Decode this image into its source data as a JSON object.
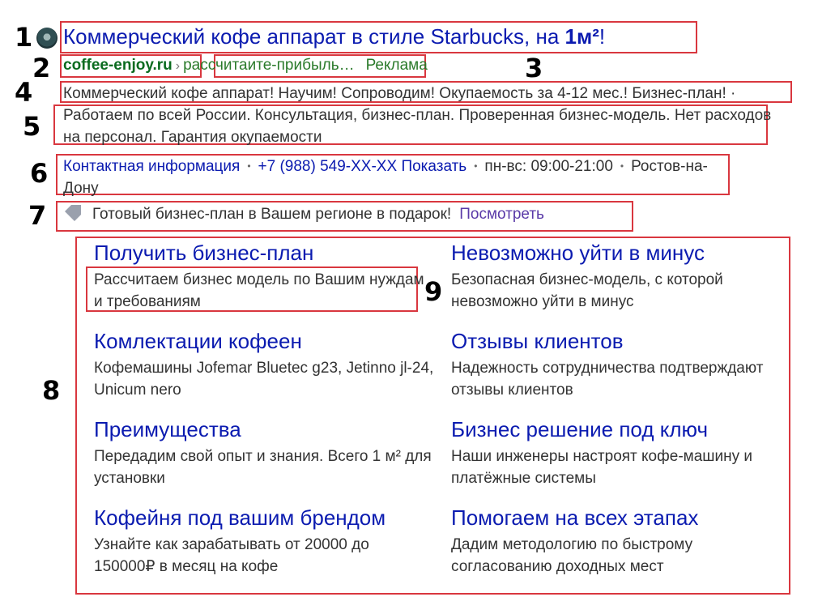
{
  "annotations": {
    "n1": "1",
    "n2": "2",
    "n3": "3",
    "n4": "4",
    "n5": "5",
    "n6": "6",
    "n7": "7",
    "n8": "8",
    "n9": "9"
  },
  "ad": {
    "logo_icon": "coffee-logo-icon",
    "title_main": "Коммерческий кофе аппарат в стиле Starbucks, на ",
    "title_bold": "1м²",
    "title_end": "!",
    "domain": "coffee-enjoy.ru",
    "breadcrumb_sep": "›",
    "path": "рассчитаите-прибыль…",
    "ad_label": "Реклама",
    "description": "Коммерческий кофе аппарат! Научим! Сопроводим! Окупаемость за 4-12 мес.! Бизнес-план! · Работаем по всей России. Консультация, бизнес-план. Проверенная бизнес-модель. Нет расходов на персонал. Гарантия окупаемости",
    "contacts": {
      "contact_info": "Контактная информация",
      "phone": "+7 (988) 549-XX-XX",
      "show": "Показать",
      "hours": "пн-вс: 09:00-21:00",
      "city": "Ростов-на-Дону",
      "dot": "•"
    },
    "promo": {
      "icon": "tag-icon",
      "text": "Готовый бизнес-план в Вашем регионе в подарок!",
      "link": "Посмотреть"
    },
    "sitelinks": [
      {
        "title": "Получить бизнес-план",
        "text": "Рассчитаем бизнес модель по Вашим нуждам и требованиям"
      },
      {
        "title": "Невозможно уйти в минус",
        "text": "Безопасная бизнес-модель, с которой невозможно уйти в минус"
      },
      {
        "title": "Комлектации кофеен",
        "text": "Кофемашины Jofemar Bluetec g23, Jetinno jl-24, Unicum nero"
      },
      {
        "title": "Отзывы клиентов",
        "text": "Надежность сотрудничества подтверждают отзывы клиентов"
      },
      {
        "title": "Преимущества",
        "text": "Передадим свой опыт и знания. Всего 1 м² для установки"
      },
      {
        "title": "Бизнес решение под ключ",
        "text": "Наши инженеры настроят кофе-машину и платёжные системы"
      },
      {
        "title": "Кофейня под вашим брендом",
        "text": "Узнайте как зарабатывать от 20000 до 150000₽ в месяц на кофе"
      },
      {
        "title": "Помогаем на всех этапах",
        "text": "Дадим методологию по быстрому согласованию доходных мест"
      }
    ]
  },
  "colors": {
    "annotation_box": "#d9373f",
    "title_link": "#0b1bb0",
    "domain": "#0b6b1f",
    "promo_link": "#5a3aa8"
  }
}
